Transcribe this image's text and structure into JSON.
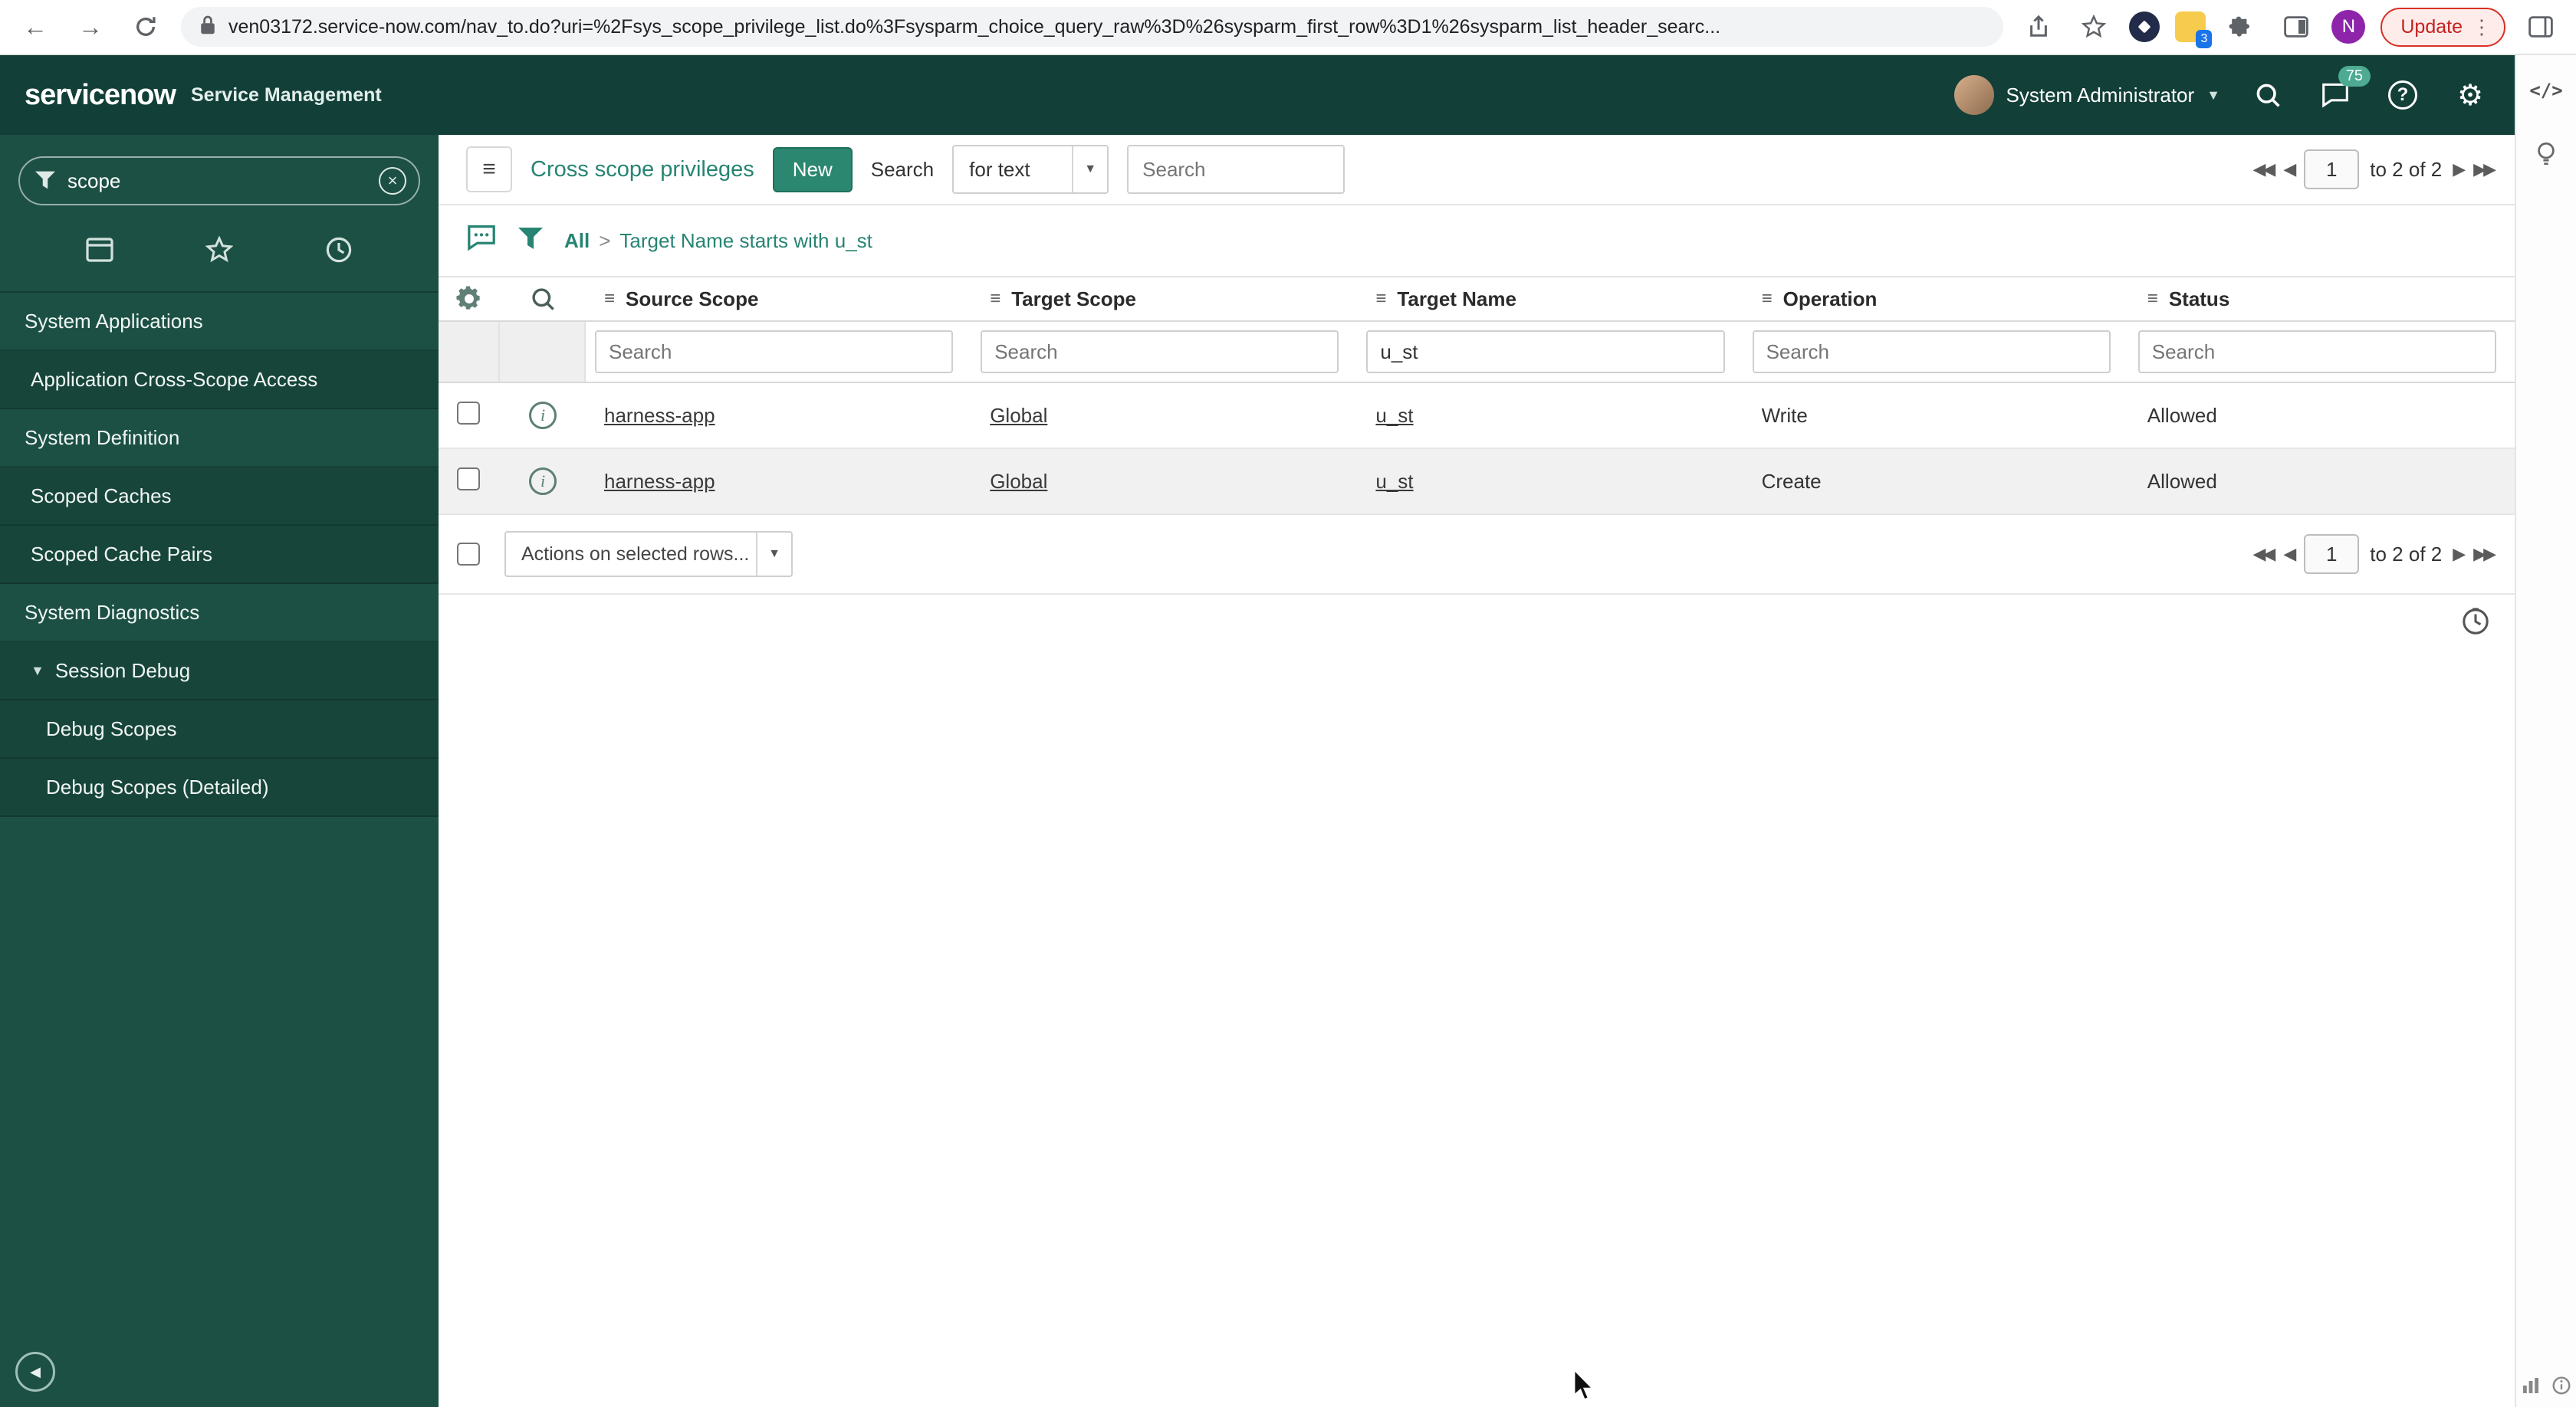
{
  "browser": {
    "url": "ven03172.service-now.com/nav_to.do?uri=%2Fsys_scope_privilege_list.do%3Fsysparm_choice_query_raw%3D%26sysparm_first_row%3D1%26sysparm_list_header_searc...",
    "update_label": "Update",
    "extension_badge": "3",
    "avatar_initial": "N"
  },
  "header": {
    "logo": "servicenow",
    "product": "Service Management",
    "user": "System Administrator",
    "notification_count": "75"
  },
  "sidebar": {
    "filter_value": "scope",
    "items": [
      {
        "label": "System Applications"
      },
      {
        "label": "Application Cross-Scope Access"
      },
      {
        "label": "System Definition"
      },
      {
        "label": "Scoped Caches"
      },
      {
        "label": "Scoped Cache Pairs"
      },
      {
        "label": "System Diagnostics"
      },
      {
        "label": "Session Debug"
      },
      {
        "label": "Debug Scopes"
      },
      {
        "label": "Debug Scopes (Detailed)"
      }
    ]
  },
  "list": {
    "title": "Cross scope privileges",
    "new_button": "New",
    "search_label": "Search",
    "search_type": "for text",
    "search_placeholder": "Search",
    "breadcrumb": {
      "root": "All",
      "separator": ">",
      "query": "Target Name starts with u_st"
    },
    "pagination": {
      "page": "1",
      "info": "to 2 of 2"
    },
    "columns": [
      {
        "label": "Source Scope"
      },
      {
        "label": "Target Scope"
      },
      {
        "label": "Target Name"
      },
      {
        "label": "Operation"
      },
      {
        "label": "Status"
      }
    ],
    "filters": {
      "target_name": "u_st"
    },
    "rows": [
      {
        "source_scope": "harness-app",
        "target_scope": "Global",
        "target_name": "u_st",
        "operation": "Write",
        "status": "Allowed"
      },
      {
        "source_scope": "harness-app",
        "target_scope": "Global",
        "target_name": "u_st",
        "operation": "Create",
        "status": "Allowed"
      }
    ],
    "actions_label": "Actions on selected rows..."
  }
}
